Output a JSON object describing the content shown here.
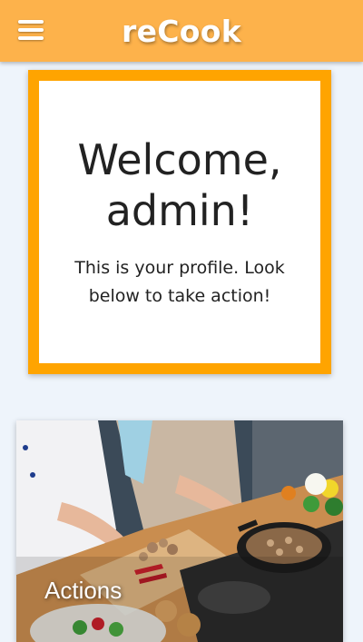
{
  "header": {
    "title": "reCook",
    "menu_icon": "hamburger-menu-icon"
  },
  "welcome": {
    "title": "Welcome, admin!",
    "subtitle": "This is your profile. Look below to take action!"
  },
  "actions_card": {
    "label": "Actions",
    "image": "cooking-kitchen-photo"
  },
  "colors": {
    "header_bg": "#fdb24b",
    "card_border": "#ffa400",
    "page_bg": "#eef4fb"
  }
}
